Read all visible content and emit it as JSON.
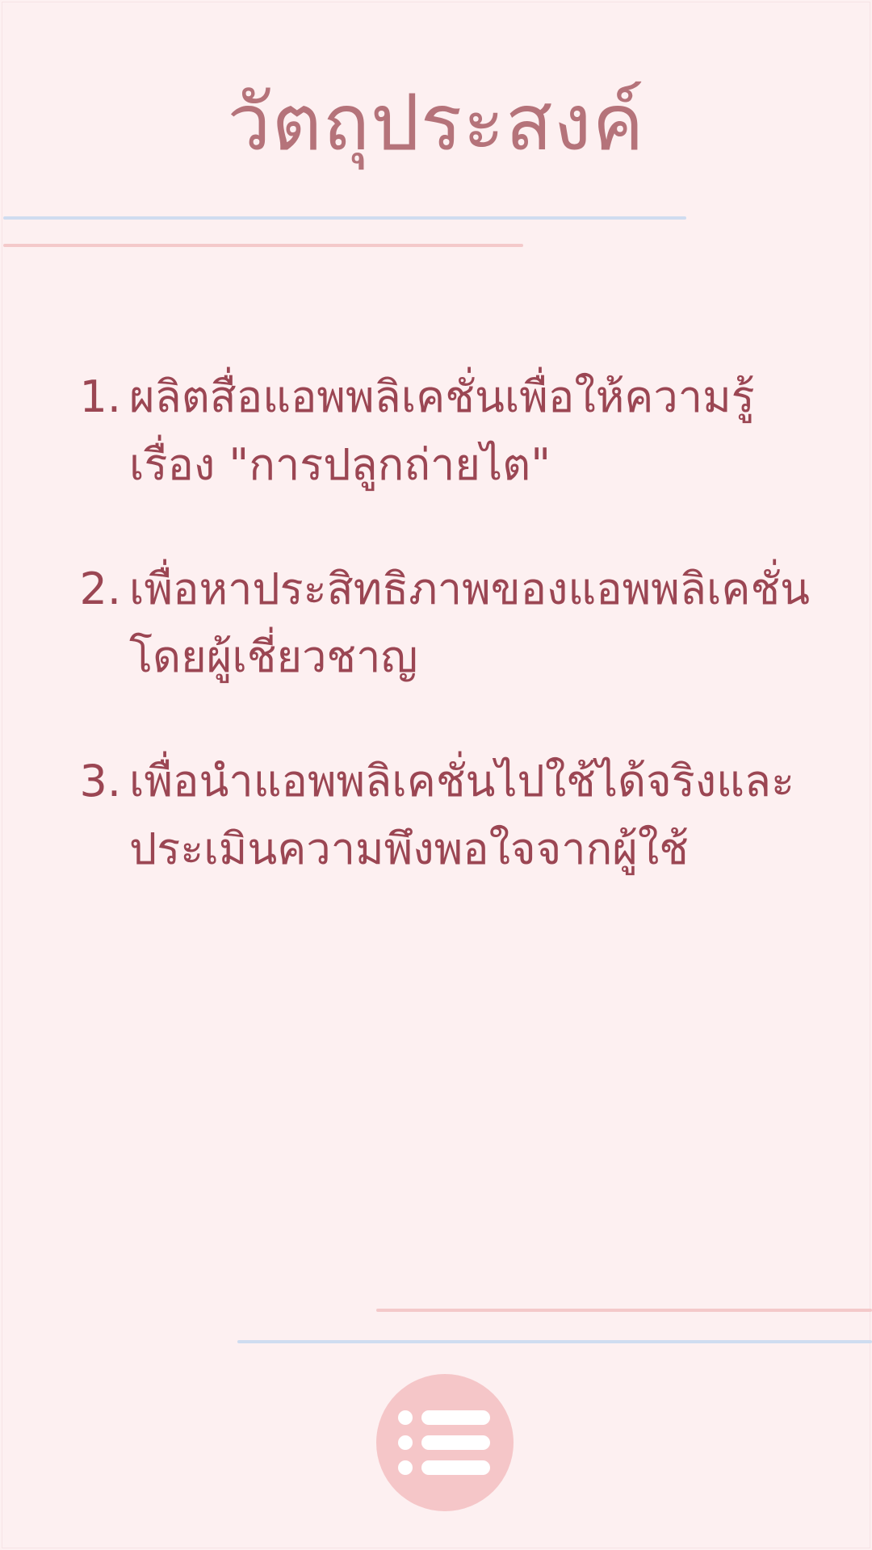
{
  "page": {
    "title": "วัตถุประสงค์"
  },
  "objectives": [
    {
      "number": "1.",
      "lines": [
        "ผลิตสื่อแอพพลิเคชั่นเพื่อให้ความรู้",
        "เรื่อง \"การปลูกถ่ายไต\""
      ]
    },
    {
      "number": "2.",
      "lines": [
        "เพื่อหาประสิทธิภาพของแอพพลิเคชั่น",
        "โดยผู้เชี่ยวชาญ"
      ]
    },
    {
      "number": "3.",
      "lines": [
        "เพื่อนำแอพพลิเคชั่นไปใช้ได้จริงและ",
        "ประเมินความพึงพอใจจากผู้ใช้"
      ]
    }
  ],
  "menu": {
    "icon": "menu-list-icon"
  },
  "colors": {
    "background": "#fdf0f1",
    "title": "#b5737a",
    "text": "#9b4653",
    "accent_pink": "#f4c9ca",
    "accent_blue": "#cfdcf0",
    "menu_circle": "#f5c6c8"
  }
}
